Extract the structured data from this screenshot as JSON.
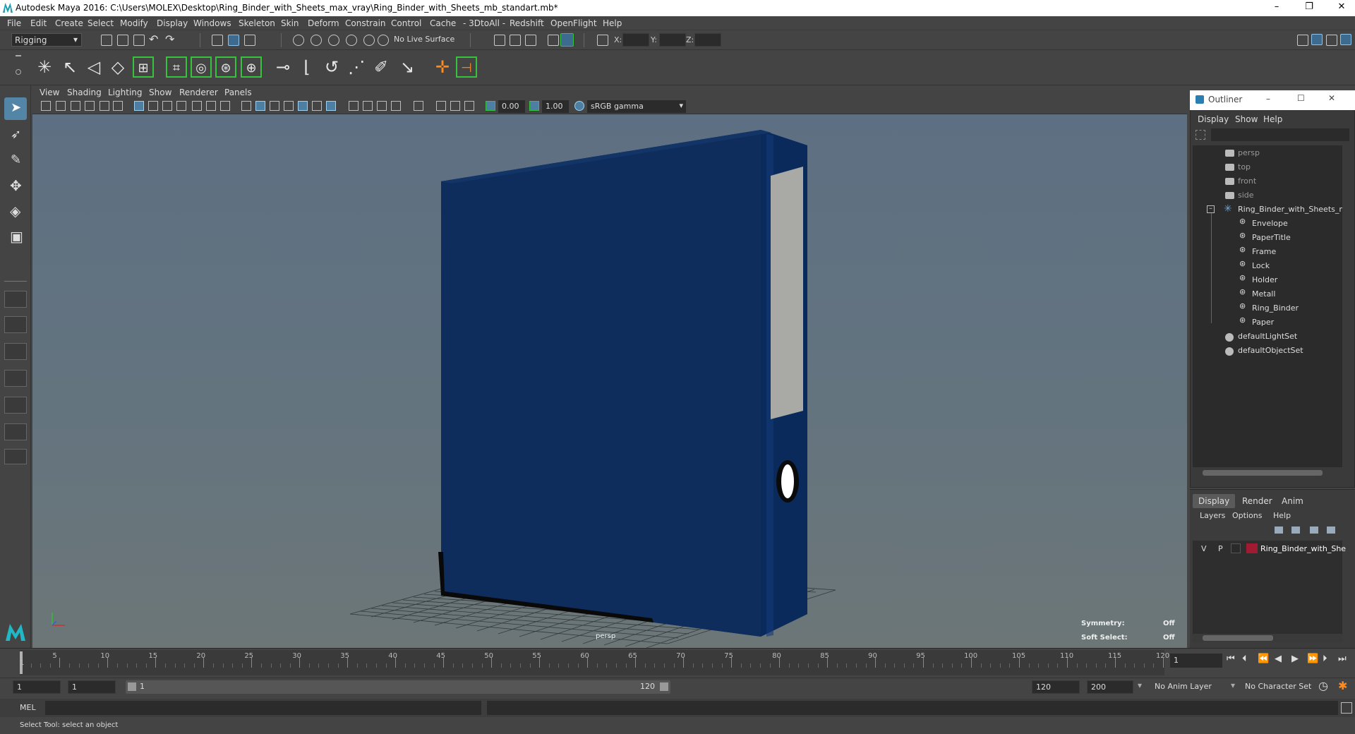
{
  "window": {
    "title": "Autodesk Maya 2016: C:\\Users\\MOLEX\\Desktop\\Ring_Binder_with_Sheets_max_vray\\Ring_Binder_with_Sheets_mb_standart.mb*",
    "minimize": "–",
    "restore": "❐",
    "close": "✕"
  },
  "menu": [
    "File",
    "Edit",
    "Create",
    "Select",
    "Modify",
    "Display",
    "Windows",
    "Skeleton",
    "Skin",
    "Deform",
    "Constrain",
    "Control",
    "Cache",
    "- 3DtoAll -",
    "Redshift",
    "OpenFlight",
    "Help"
  ],
  "toolbar": {
    "mode": "Rigging",
    "live_surface": "No Live Surface",
    "x_label": "X:",
    "y_label": "Y:",
    "z_label": "Z:"
  },
  "viewport_menu": [
    "View",
    "Shading",
    "Lighting",
    "Show",
    "Renderer",
    "Panels"
  ],
  "viewport_toolbar": {
    "exposure": "0.00",
    "gamma": "1.00",
    "colorspace": "sRGB gamma"
  },
  "viewport": {
    "camera": "persp",
    "symmetry_label": "Symmetry:",
    "symmetry_value": "Off",
    "soft_select_label": "Soft Select:",
    "soft_select_value": "Off"
  },
  "outliner": {
    "title": "Outliner",
    "menu": [
      "Display",
      "Show",
      "Help"
    ],
    "cameras": [
      "persp",
      "top",
      "front",
      "side"
    ],
    "root": "Ring_Binder_with_Sheets_nc",
    "children": [
      "Envelope",
      "PaperTitle",
      "Frame",
      "Lock",
      "Holder",
      "Metall",
      "Ring_Binder",
      "Paper"
    ],
    "sets": [
      "defaultLightSet",
      "defaultObjectSet"
    ]
  },
  "layers": {
    "tabs": [
      "Display",
      "Render",
      "Anim"
    ],
    "menu": [
      "Layers",
      "Options",
      "Help"
    ],
    "row": {
      "v": "V",
      "p": "P",
      "name": "Ring_Binder_with_She",
      "color": "#a01b32"
    }
  },
  "timeline": {
    "ticks": [
      "5",
      "10",
      "15",
      "20",
      "25",
      "30",
      "35",
      "40",
      "45",
      "50",
      "55",
      "60",
      "65",
      "70",
      "75",
      "80",
      "85",
      "90",
      "95",
      "100",
      "105",
      "110",
      "115",
      "120"
    ],
    "start_tick": "1",
    "current_frame": "1"
  },
  "range": {
    "start": "1",
    "playback_start": "1",
    "slider_start": "1",
    "slider_end": "120",
    "playback_end": "120",
    "end": "200",
    "anim_layer": "No Anim Layer",
    "character_set": "No Character Set"
  },
  "command": {
    "label": "MEL"
  },
  "status": {
    "text": "Select Tool: select an object"
  },
  "colors": {
    "binder": "#0d2b57",
    "layer": "#a01b32",
    "highlight": "#5285a6"
  }
}
